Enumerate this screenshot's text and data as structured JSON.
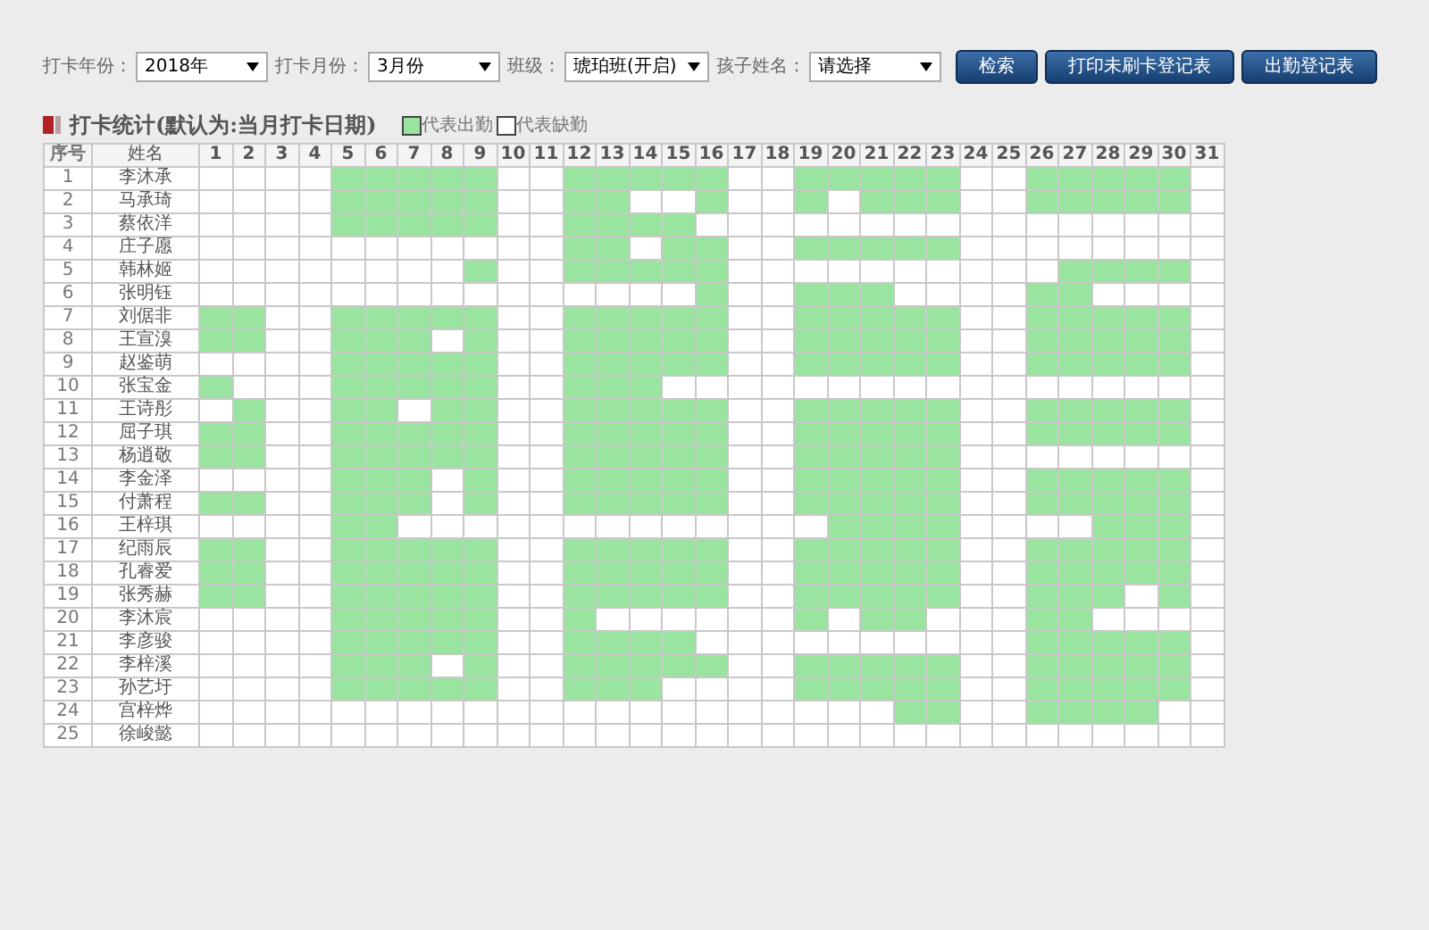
{
  "filters": [
    {
      "label": "打卡年份：",
      "value": "2018年"
    },
    {
      "label": "打卡月份：",
      "value": "3月份"
    },
    {
      "label": "班级：",
      "value": "琥珀班(开启)"
    },
    {
      "label": "孩子姓名：",
      "value": "请选择"
    }
  ],
  "buttons": [
    "检索",
    "打印未刷卡登记表",
    "出勤登记表"
  ],
  "section_title": "打卡统计(默认为:当月打卡日期)",
  "legend": [
    {
      "label": "代表出勤",
      "present": true
    },
    {
      "label": "代表缺勤",
      "present": false
    }
  ],
  "table": {
    "columns": [
      "序号",
      "姓名"
    ],
    "days": [
      "1",
      "2",
      "3",
      "4",
      "5",
      "6",
      "7",
      "8",
      "9",
      "10",
      "11",
      "12",
      "13",
      "14",
      "15",
      "16",
      "17",
      "18",
      "19",
      "20",
      "21",
      "22",
      "23",
      "24",
      "25",
      "26",
      "27",
      "28",
      "29",
      "30",
      "31"
    ],
    "rows": [
      {
        "no": "1",
        "name": "李沐承",
        "present": [
          false,
          false,
          false,
          false,
          true,
          true,
          true,
          true,
          true,
          false,
          false,
          true,
          true,
          true,
          true,
          true,
          false,
          false,
          true,
          true,
          true,
          true,
          true,
          false,
          false,
          true,
          true,
          true,
          true,
          true,
          false
        ]
      },
      {
        "no": "2",
        "name": "马承琦",
        "present": [
          false,
          false,
          false,
          false,
          true,
          true,
          true,
          true,
          true,
          false,
          false,
          true,
          true,
          false,
          false,
          true,
          false,
          false,
          true,
          false,
          true,
          true,
          true,
          false,
          false,
          true,
          true,
          true,
          true,
          true,
          false
        ]
      },
      {
        "no": "3",
        "name": "蔡依洋",
        "present": [
          false,
          false,
          false,
          false,
          true,
          true,
          true,
          true,
          true,
          false,
          false,
          true,
          true,
          true,
          true,
          false,
          false,
          false,
          false,
          false,
          false,
          false,
          false,
          false,
          false,
          false,
          false,
          false,
          false,
          false,
          false
        ]
      },
      {
        "no": "4",
        "name": "庄子愿",
        "present": [
          false,
          false,
          false,
          false,
          false,
          false,
          false,
          false,
          false,
          false,
          false,
          true,
          true,
          false,
          true,
          true,
          false,
          false,
          true,
          true,
          true,
          true,
          true,
          false,
          false,
          false,
          false,
          false,
          false,
          false,
          false
        ]
      },
      {
        "no": "5",
        "name": "韩林姬",
        "present": [
          false,
          false,
          false,
          false,
          false,
          false,
          false,
          false,
          true,
          false,
          false,
          true,
          true,
          true,
          true,
          true,
          false,
          false,
          false,
          false,
          false,
          false,
          false,
          false,
          false,
          false,
          true,
          true,
          true,
          true,
          false
        ]
      },
      {
        "no": "6",
        "name": "张明钰",
        "present": [
          false,
          false,
          false,
          false,
          false,
          false,
          false,
          false,
          false,
          false,
          false,
          false,
          false,
          false,
          false,
          true,
          false,
          false,
          true,
          true,
          true,
          false,
          false,
          false,
          false,
          true,
          true,
          false,
          false,
          false,
          false
        ]
      },
      {
        "no": "7",
        "name": "刘倨非",
        "present": [
          true,
          true,
          false,
          false,
          true,
          true,
          true,
          true,
          true,
          false,
          false,
          true,
          true,
          true,
          true,
          true,
          false,
          false,
          true,
          true,
          true,
          true,
          true,
          false,
          false,
          true,
          true,
          true,
          true,
          true,
          false
        ]
      },
      {
        "no": "8",
        "name": "王宣溴",
        "present": [
          true,
          true,
          false,
          false,
          true,
          true,
          true,
          false,
          true,
          false,
          false,
          true,
          true,
          true,
          true,
          true,
          false,
          false,
          true,
          true,
          true,
          true,
          true,
          false,
          false,
          true,
          true,
          true,
          true,
          true,
          false
        ]
      },
      {
        "no": "9",
        "name": "赵鉴萌",
        "present": [
          false,
          false,
          false,
          false,
          true,
          true,
          true,
          true,
          true,
          false,
          false,
          true,
          true,
          true,
          true,
          true,
          false,
          false,
          true,
          true,
          true,
          true,
          true,
          false,
          false,
          true,
          true,
          true,
          true,
          true,
          false
        ]
      },
      {
        "no": "10",
        "name": "张宝金",
        "present": [
          true,
          false,
          false,
          false,
          true,
          true,
          true,
          true,
          true,
          false,
          false,
          true,
          true,
          true,
          false,
          false,
          false,
          false,
          false,
          false,
          false,
          false,
          false,
          false,
          false,
          false,
          false,
          false,
          false,
          false,
          false
        ]
      },
      {
        "no": "11",
        "name": "王诗彤",
        "present": [
          false,
          true,
          false,
          false,
          true,
          true,
          false,
          true,
          true,
          false,
          false,
          true,
          true,
          true,
          true,
          true,
          false,
          false,
          true,
          true,
          true,
          true,
          true,
          false,
          false,
          true,
          true,
          true,
          true,
          true,
          false
        ]
      },
      {
        "no": "12",
        "name": "屈子琪",
        "present": [
          true,
          true,
          false,
          false,
          true,
          true,
          true,
          true,
          true,
          false,
          false,
          true,
          true,
          true,
          true,
          true,
          false,
          false,
          true,
          true,
          true,
          true,
          true,
          false,
          false,
          true,
          true,
          true,
          true,
          true,
          false
        ]
      },
      {
        "no": "13",
        "name": "杨逍敬",
        "present": [
          true,
          true,
          false,
          false,
          true,
          true,
          true,
          true,
          true,
          false,
          false,
          true,
          true,
          true,
          true,
          true,
          false,
          false,
          true,
          true,
          true,
          true,
          true,
          false,
          false,
          false,
          false,
          false,
          false,
          false,
          false
        ]
      },
      {
        "no": "14",
        "name": "李金泽",
        "present": [
          false,
          false,
          false,
          false,
          true,
          true,
          true,
          false,
          true,
          false,
          false,
          true,
          true,
          true,
          true,
          true,
          false,
          false,
          true,
          true,
          true,
          true,
          true,
          false,
          false,
          true,
          true,
          true,
          true,
          true,
          false
        ]
      },
      {
        "no": "15",
        "name": "付萧程",
        "present": [
          true,
          true,
          false,
          false,
          true,
          true,
          true,
          false,
          true,
          false,
          false,
          true,
          true,
          true,
          true,
          true,
          false,
          false,
          true,
          true,
          true,
          true,
          true,
          false,
          false,
          true,
          true,
          true,
          true,
          true,
          false
        ]
      },
      {
        "no": "16",
        "name": "王梓琪",
        "present": [
          false,
          false,
          false,
          false,
          true,
          true,
          false,
          false,
          false,
          false,
          false,
          false,
          false,
          false,
          false,
          false,
          false,
          false,
          false,
          true,
          true,
          true,
          true,
          false,
          false,
          false,
          false,
          true,
          true,
          true,
          false
        ]
      },
      {
        "no": "17",
        "name": "纪雨辰",
        "present": [
          true,
          true,
          false,
          false,
          true,
          true,
          true,
          true,
          true,
          false,
          false,
          true,
          true,
          true,
          true,
          true,
          false,
          false,
          true,
          true,
          true,
          true,
          true,
          false,
          false,
          true,
          true,
          true,
          true,
          true,
          false
        ]
      },
      {
        "no": "18",
        "name": "孔睿爱",
        "present": [
          true,
          true,
          false,
          false,
          true,
          true,
          true,
          true,
          true,
          false,
          false,
          true,
          true,
          true,
          true,
          true,
          false,
          false,
          true,
          true,
          true,
          true,
          true,
          false,
          false,
          true,
          true,
          true,
          true,
          true,
          false
        ]
      },
      {
        "no": "19",
        "name": "张秀赫",
        "present": [
          true,
          true,
          false,
          false,
          true,
          true,
          true,
          true,
          true,
          false,
          false,
          true,
          true,
          true,
          true,
          true,
          false,
          false,
          true,
          true,
          true,
          true,
          true,
          false,
          false,
          true,
          true,
          true,
          false,
          true,
          false
        ]
      },
      {
        "no": "20",
        "name": "李沐宸",
        "present": [
          false,
          false,
          false,
          false,
          true,
          true,
          true,
          true,
          true,
          false,
          false,
          true,
          false,
          false,
          false,
          false,
          false,
          false,
          true,
          false,
          true,
          true,
          false,
          false,
          false,
          true,
          true,
          false,
          false,
          false,
          false
        ]
      },
      {
        "no": "21",
        "name": "李彦骏",
        "present": [
          false,
          false,
          false,
          false,
          true,
          true,
          true,
          true,
          true,
          false,
          false,
          true,
          true,
          true,
          true,
          false,
          false,
          false,
          false,
          false,
          false,
          false,
          false,
          false,
          false,
          true,
          true,
          true,
          true,
          true,
          false
        ]
      },
      {
        "no": "22",
        "name": "李梓溪",
        "present": [
          false,
          false,
          false,
          false,
          true,
          true,
          true,
          false,
          true,
          false,
          false,
          true,
          true,
          true,
          true,
          true,
          false,
          false,
          true,
          true,
          true,
          true,
          true,
          false,
          false,
          true,
          true,
          true,
          true,
          true,
          false
        ]
      },
      {
        "no": "23",
        "name": "孙艺圩",
        "present": [
          false,
          false,
          false,
          false,
          true,
          true,
          true,
          true,
          true,
          false,
          false,
          true,
          true,
          true,
          false,
          false,
          false,
          false,
          true,
          true,
          true,
          true,
          true,
          false,
          false,
          true,
          true,
          true,
          true,
          true,
          false
        ]
      },
      {
        "no": "24",
        "name": "宫梓烨",
        "present": [
          false,
          false,
          false,
          false,
          false,
          false,
          false,
          false,
          false,
          false,
          false,
          false,
          false,
          false,
          false,
          false,
          false,
          false,
          false,
          false,
          false,
          true,
          true,
          false,
          false,
          true,
          true,
          true,
          true,
          false,
          false
        ]
      },
      {
        "no": "25",
        "name": "徐峻懿",
        "present": [
          false,
          false,
          false,
          false,
          false,
          false,
          false,
          false,
          false,
          false,
          false,
          false,
          false,
          false,
          false,
          false,
          false,
          false,
          false,
          false,
          false,
          false,
          false,
          false,
          false,
          false,
          false,
          false,
          false,
          false,
          false
        ]
      }
    ]
  }
}
